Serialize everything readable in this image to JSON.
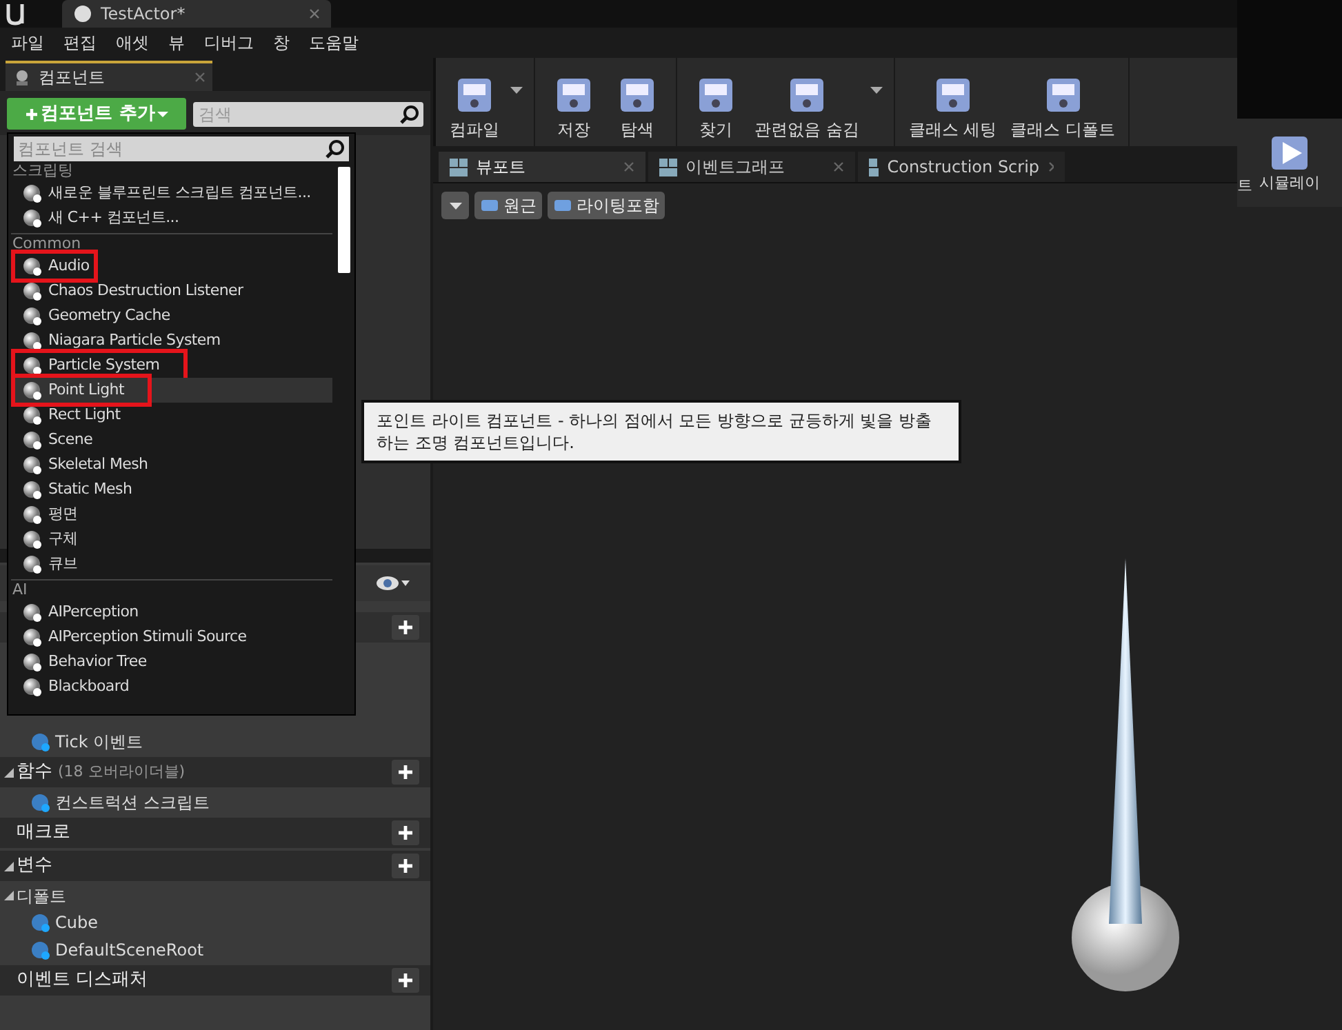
{
  "window": {
    "tabs": [
      {
        "label": "TestActor*",
        "selected": true
      }
    ]
  },
  "menu": [
    "파일",
    "편집",
    "애셋",
    "뷰",
    "디버그",
    "창",
    "도움말"
  ],
  "components_panel": {
    "tab": "컴포넌트",
    "add_button": "컴포넌트 추가",
    "search": {
      "placeholder": "검색"
    }
  },
  "add_menu": {
    "search": {
      "placeholder": "컴포넌트 검색"
    },
    "sections": [
      {
        "title": "스크립팅",
        "items": [
          {
            "label": "새로운 블루프린트 스크립트 컴포넌트...",
            "highlighted": false,
            "selected": false
          },
          {
            "label": "새 C++ 컴포넌트...",
            "highlighted": false,
            "selected": false
          }
        ]
      },
      {
        "title": "Common",
        "items": [
          {
            "label": "Audio",
            "highlighted": true,
            "selected": false
          },
          {
            "label": "Chaos Destruction Listener",
            "highlighted": false,
            "selected": false
          },
          {
            "label": "Geometry Cache",
            "highlighted": false,
            "selected": false
          },
          {
            "label": "Niagara Particle System",
            "highlighted": false,
            "selected": false
          },
          {
            "label": "Particle System",
            "highlighted": true,
            "selected": false
          },
          {
            "label": "Point Light",
            "highlighted": true,
            "selected": true
          },
          {
            "label": "Rect Light",
            "highlighted": false,
            "selected": false
          },
          {
            "label": "Scene",
            "highlighted": false,
            "selected": false
          },
          {
            "label": "Skeletal Mesh",
            "highlighted": false,
            "selected": false
          },
          {
            "label": "Static Mesh",
            "highlighted": false,
            "selected": false
          },
          {
            "label": "평면",
            "highlighted": false,
            "selected": false
          },
          {
            "label": "구체",
            "highlighted": false,
            "selected": false
          },
          {
            "label": "큐브",
            "highlighted": false,
            "selected": false
          }
        ]
      },
      {
        "title": "AI",
        "items": [
          {
            "label": "AIPerception",
            "highlighted": false,
            "selected": false
          },
          {
            "label": "AIPerception Stimuli Source",
            "highlighted": false,
            "selected": false
          },
          {
            "label": "Behavior Tree",
            "highlighted": false,
            "selected": false
          },
          {
            "label": "Blackboard",
            "highlighted": false,
            "selected": false
          }
        ]
      }
    ]
  },
  "tooltip": "포인트 라이트 컴포넌트 - 하나의 점에서 모든 방향으로 균등하게 빛을 방출하는 조명 컴포넌트입니다.",
  "my_blueprint": [
    {
      "kind": "item",
      "label": "Tick 이벤트"
    },
    {
      "kind": "header",
      "label": "함수",
      "note": "(18 오버라이더블)",
      "expanded": true
    },
    {
      "kind": "item",
      "label": "컨스트럭션 스크립트"
    },
    {
      "kind": "header",
      "label": "매크로"
    },
    {
      "kind": "header",
      "label": "변수",
      "expanded": true
    },
    {
      "kind": "category",
      "label": "디폴트"
    },
    {
      "kind": "item",
      "label": "Cube"
    },
    {
      "kind": "item",
      "label": "DefaultSceneRoot"
    },
    {
      "kind": "header",
      "label": "이벤트 디스패처"
    }
  ],
  "toolbar": [
    [
      {
        "label": "컴파일",
        "dropdown": true
      }
    ],
    [
      {
        "label": "저장"
      },
      {
        "label": "탐색"
      }
    ],
    [
      {
        "label": "찾기"
      },
      {
        "label": "관련없음 숨김",
        "dropdown": true
      }
    ],
    [
      {
        "label": "클래스 세팅"
      },
      {
        "label": "클래스 디폴트"
      }
    ]
  ],
  "editor_tabs": [
    {
      "label": "뷰포트",
      "selected": true
    },
    {
      "label": "이벤트그래프",
      "selected": false
    },
    {
      "label": "Construction Scrip",
      "selected": false
    }
  ],
  "viewport": {
    "buttons": [
      "원근",
      "라이팅포함"
    ]
  },
  "second_window": {
    "edge_text": "트",
    "button": "시뮬레이"
  }
}
